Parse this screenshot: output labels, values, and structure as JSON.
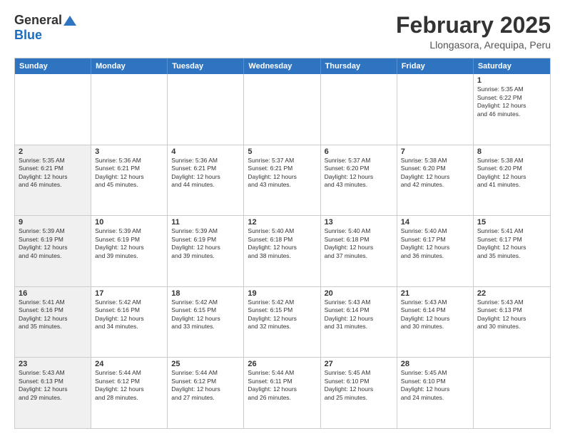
{
  "logo": {
    "general": "General",
    "blue": "Blue"
  },
  "title": "February 2025",
  "location": "Llongasora, Arequipa, Peru",
  "header_days": [
    "Sunday",
    "Monday",
    "Tuesday",
    "Wednesday",
    "Thursday",
    "Friday",
    "Saturday"
  ],
  "weeks": [
    [
      {
        "day": "",
        "info": "",
        "shaded": false
      },
      {
        "day": "",
        "info": "",
        "shaded": false
      },
      {
        "day": "",
        "info": "",
        "shaded": false
      },
      {
        "day": "",
        "info": "",
        "shaded": false
      },
      {
        "day": "",
        "info": "",
        "shaded": false
      },
      {
        "day": "",
        "info": "",
        "shaded": false
      },
      {
        "day": "1",
        "info": "Sunrise: 5:35 AM\nSunset: 6:22 PM\nDaylight: 12 hours\nand 46 minutes.",
        "shaded": false
      }
    ],
    [
      {
        "day": "2",
        "info": "Sunrise: 5:35 AM\nSunset: 6:21 PM\nDaylight: 12 hours\nand 46 minutes.",
        "shaded": true
      },
      {
        "day": "3",
        "info": "Sunrise: 5:36 AM\nSunset: 6:21 PM\nDaylight: 12 hours\nand 45 minutes.",
        "shaded": false
      },
      {
        "day": "4",
        "info": "Sunrise: 5:36 AM\nSunset: 6:21 PM\nDaylight: 12 hours\nand 44 minutes.",
        "shaded": false
      },
      {
        "day": "5",
        "info": "Sunrise: 5:37 AM\nSunset: 6:21 PM\nDaylight: 12 hours\nand 43 minutes.",
        "shaded": false
      },
      {
        "day": "6",
        "info": "Sunrise: 5:37 AM\nSunset: 6:20 PM\nDaylight: 12 hours\nand 43 minutes.",
        "shaded": false
      },
      {
        "day": "7",
        "info": "Sunrise: 5:38 AM\nSunset: 6:20 PM\nDaylight: 12 hours\nand 42 minutes.",
        "shaded": false
      },
      {
        "day": "8",
        "info": "Sunrise: 5:38 AM\nSunset: 6:20 PM\nDaylight: 12 hours\nand 41 minutes.",
        "shaded": false
      }
    ],
    [
      {
        "day": "9",
        "info": "Sunrise: 5:39 AM\nSunset: 6:19 PM\nDaylight: 12 hours\nand 40 minutes.",
        "shaded": true
      },
      {
        "day": "10",
        "info": "Sunrise: 5:39 AM\nSunset: 6:19 PM\nDaylight: 12 hours\nand 39 minutes.",
        "shaded": false
      },
      {
        "day": "11",
        "info": "Sunrise: 5:39 AM\nSunset: 6:19 PM\nDaylight: 12 hours\nand 39 minutes.",
        "shaded": false
      },
      {
        "day": "12",
        "info": "Sunrise: 5:40 AM\nSunset: 6:18 PM\nDaylight: 12 hours\nand 38 minutes.",
        "shaded": false
      },
      {
        "day": "13",
        "info": "Sunrise: 5:40 AM\nSunset: 6:18 PM\nDaylight: 12 hours\nand 37 minutes.",
        "shaded": false
      },
      {
        "day": "14",
        "info": "Sunrise: 5:40 AM\nSunset: 6:17 PM\nDaylight: 12 hours\nand 36 minutes.",
        "shaded": false
      },
      {
        "day": "15",
        "info": "Sunrise: 5:41 AM\nSunset: 6:17 PM\nDaylight: 12 hours\nand 35 minutes.",
        "shaded": false
      }
    ],
    [
      {
        "day": "16",
        "info": "Sunrise: 5:41 AM\nSunset: 6:16 PM\nDaylight: 12 hours\nand 35 minutes.",
        "shaded": true
      },
      {
        "day": "17",
        "info": "Sunrise: 5:42 AM\nSunset: 6:16 PM\nDaylight: 12 hours\nand 34 minutes.",
        "shaded": false
      },
      {
        "day": "18",
        "info": "Sunrise: 5:42 AM\nSunset: 6:15 PM\nDaylight: 12 hours\nand 33 minutes.",
        "shaded": false
      },
      {
        "day": "19",
        "info": "Sunrise: 5:42 AM\nSunset: 6:15 PM\nDaylight: 12 hours\nand 32 minutes.",
        "shaded": false
      },
      {
        "day": "20",
        "info": "Sunrise: 5:43 AM\nSunset: 6:14 PM\nDaylight: 12 hours\nand 31 minutes.",
        "shaded": false
      },
      {
        "day": "21",
        "info": "Sunrise: 5:43 AM\nSunset: 6:14 PM\nDaylight: 12 hours\nand 30 minutes.",
        "shaded": false
      },
      {
        "day": "22",
        "info": "Sunrise: 5:43 AM\nSunset: 6:13 PM\nDaylight: 12 hours\nand 30 minutes.",
        "shaded": false
      }
    ],
    [
      {
        "day": "23",
        "info": "Sunrise: 5:43 AM\nSunset: 6:13 PM\nDaylight: 12 hours\nand 29 minutes.",
        "shaded": true
      },
      {
        "day": "24",
        "info": "Sunrise: 5:44 AM\nSunset: 6:12 PM\nDaylight: 12 hours\nand 28 minutes.",
        "shaded": false
      },
      {
        "day": "25",
        "info": "Sunrise: 5:44 AM\nSunset: 6:12 PM\nDaylight: 12 hours\nand 27 minutes.",
        "shaded": false
      },
      {
        "day": "26",
        "info": "Sunrise: 5:44 AM\nSunset: 6:11 PM\nDaylight: 12 hours\nand 26 minutes.",
        "shaded": false
      },
      {
        "day": "27",
        "info": "Sunrise: 5:45 AM\nSunset: 6:10 PM\nDaylight: 12 hours\nand 25 minutes.",
        "shaded": false
      },
      {
        "day": "28",
        "info": "Sunrise: 5:45 AM\nSunset: 6:10 PM\nDaylight: 12 hours\nand 24 minutes.",
        "shaded": false
      },
      {
        "day": "",
        "info": "",
        "shaded": false
      }
    ]
  ]
}
